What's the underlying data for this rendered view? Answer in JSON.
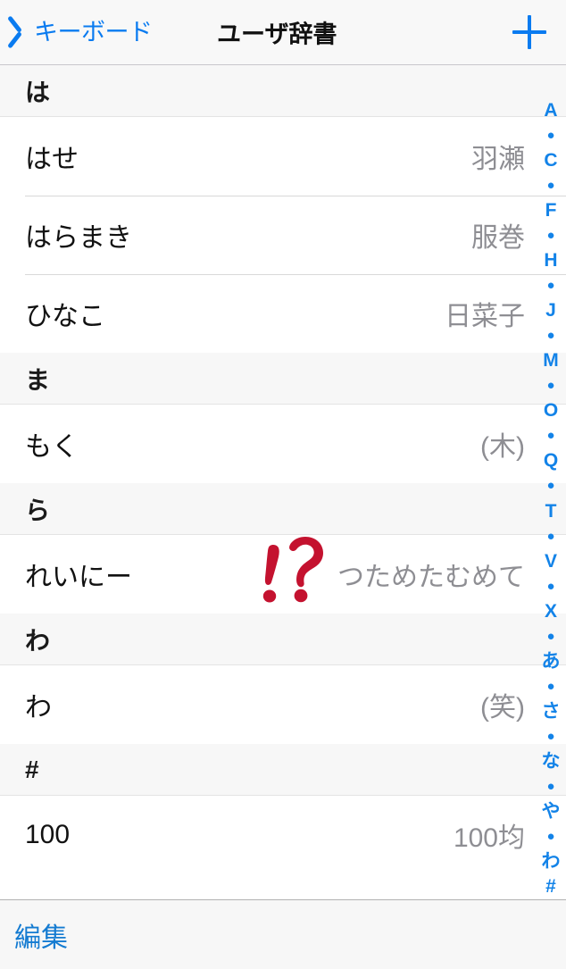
{
  "navbar": {
    "back_label": "キーボード",
    "back_icon": "chevron-left-icon",
    "title": "ユーザ辞書",
    "add_icon": "plus-icon",
    "tint_color": "#0A7BF0"
  },
  "list": {
    "sections": [
      {
        "header": "は",
        "rows": [
          {
            "key": "はせ",
            "value": "羽瀬"
          },
          {
            "key": "はらまき",
            "value": "服巻"
          },
          {
            "key": "ひなこ",
            "value": "日菜子"
          }
        ]
      },
      {
        "header": "ま",
        "rows": [
          {
            "key": "もく",
            "value": "(木)"
          }
        ]
      },
      {
        "header": "ら",
        "rows": [
          {
            "key": "れいにー",
            "value": "つためたむめて"
          }
        ]
      },
      {
        "header": "わ",
        "rows": [
          {
            "key": "わ",
            "value": "(笑)"
          }
        ]
      },
      {
        "header": "#",
        "rows": [
          {
            "key": "100",
            "value": "100均"
          }
        ]
      }
    ]
  },
  "index_bar": {
    "color": "#1383E8",
    "items": [
      "A",
      "●",
      "C",
      "●",
      "F",
      "●",
      "H",
      "●",
      "J",
      "●",
      "M",
      "●",
      "O",
      "●",
      "Q",
      "●",
      "T",
      "●",
      "V",
      "●",
      "X",
      "●",
      "あ",
      "●",
      "さ",
      "●",
      "な",
      "●",
      "や",
      "●",
      "わ",
      "#"
    ]
  },
  "annotation": {
    "glyph": "interrobang-mark",
    "color": "#C4122F"
  },
  "toolbar": {
    "edit_label": "編集",
    "tint_color": "#147BD1"
  }
}
